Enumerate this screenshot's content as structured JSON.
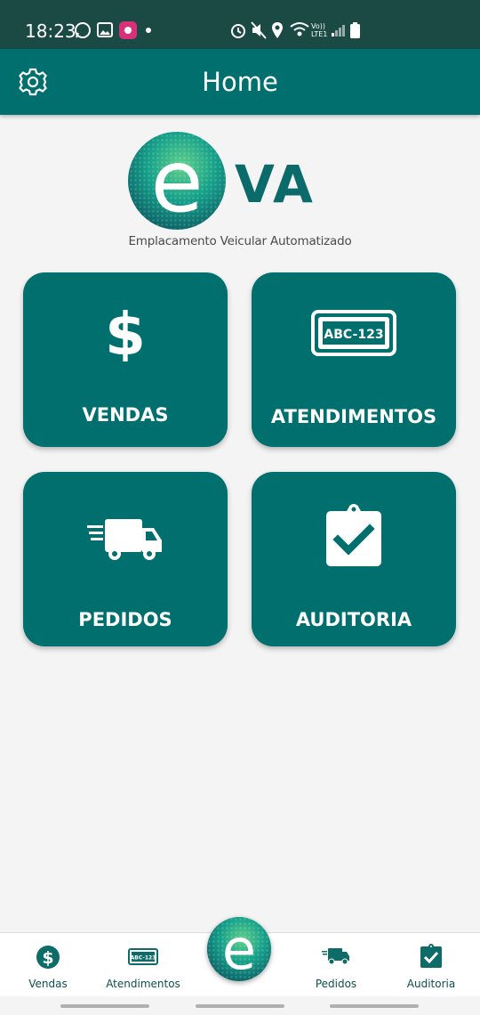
{
  "status_bar": {
    "time": "18:23",
    "network": "Vo)) LTE1"
  },
  "app_bar": {
    "title": "Home"
  },
  "logo": {
    "brand": "VA",
    "letter": "e",
    "tagline": "Emplacamento Veicular Automatizado"
  },
  "cards": [
    {
      "label": "VENDAS",
      "icon": "dollar-icon"
    },
    {
      "label": "ATENDIMENTOS",
      "icon": "license-plate-icon",
      "plate_text": "ABC-123"
    },
    {
      "label": "PEDIDOS",
      "icon": "delivery-truck-icon"
    },
    {
      "label": "AUDITORIA",
      "icon": "clipboard-check-icon"
    }
  ],
  "bottom_nav": {
    "items": [
      {
        "label": "Vendas",
        "icon": "dollar-circle-icon"
      },
      {
        "label": "Atendimentos",
        "icon": "license-plate-icon",
        "plate_text": "ABC-123"
      },
      {
        "label": "Pedidos",
        "icon": "delivery-truck-icon"
      },
      {
        "label": "Auditoria",
        "icon": "clipboard-check-icon"
      }
    ],
    "center": {
      "icon": "eva-logo-icon",
      "letter": "e"
    }
  },
  "colors": {
    "primary": "#006f6e",
    "status_bar": "#1b4a45",
    "background": "#f4f4f4",
    "nav_text": "#0d4f4c"
  }
}
